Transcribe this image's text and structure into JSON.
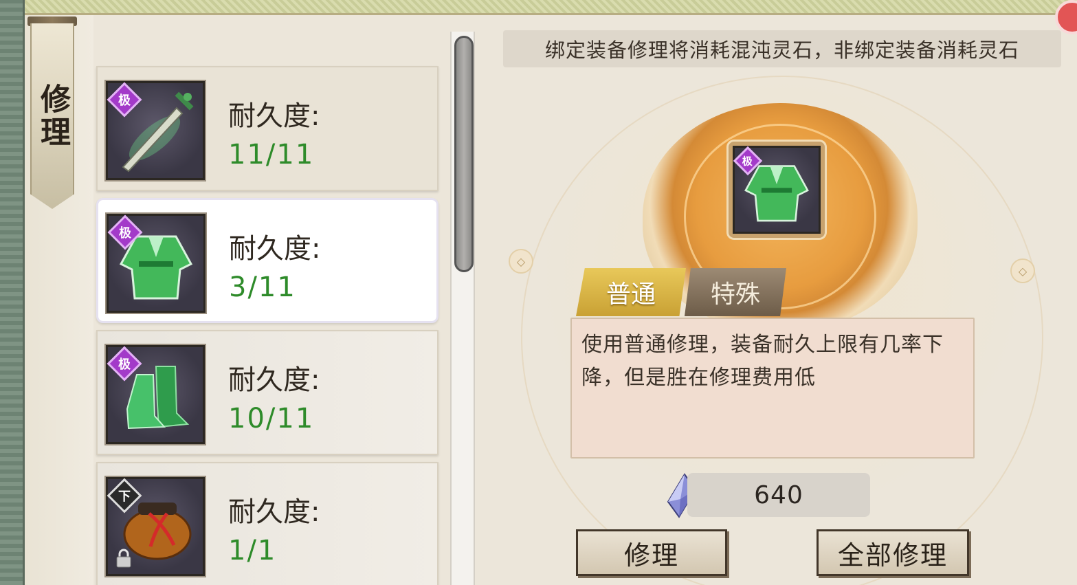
{
  "banner": {
    "title": "修理"
  },
  "equipment": [
    {
      "grade": "极",
      "item_icon": "sword-icon",
      "durability_label": "耐久度:",
      "durability_value": "11/11",
      "selected": false,
      "locked": false
    },
    {
      "grade": "极",
      "item_icon": "robe-icon",
      "durability_label": "耐久度:",
      "durability_value": "3/11",
      "selected": true,
      "locked": false
    },
    {
      "grade": "极",
      "item_icon": "boots-icon",
      "durability_label": "耐久度:",
      "durability_value": "10/11",
      "selected": false,
      "locked": false
    },
    {
      "grade": "下",
      "item_icon": "pouch-icon",
      "durability_label": "耐久度:",
      "durability_value": "1/1",
      "selected": false,
      "locked": true
    }
  ],
  "hint": "绑定装备修理将消耗混沌灵石，非绑定装备消耗灵石",
  "selected_item": {
    "grade": "极",
    "item_icon": "robe-icon"
  },
  "tabs": {
    "normal": "普通",
    "special": "特殊",
    "active": "普通"
  },
  "description": "使用普通修理，装备耐久上限有几率下降，但是胜在修理费用低",
  "cost": {
    "icon": "spirit-stone-icon",
    "value": "640"
  },
  "buttons": {
    "repair": "修理",
    "repair_all": "全部修理"
  },
  "colors": {
    "durability_green": "#2e8b2a",
    "grade_purple": "#a33ac9",
    "tab_gold": "#d9b446"
  }
}
